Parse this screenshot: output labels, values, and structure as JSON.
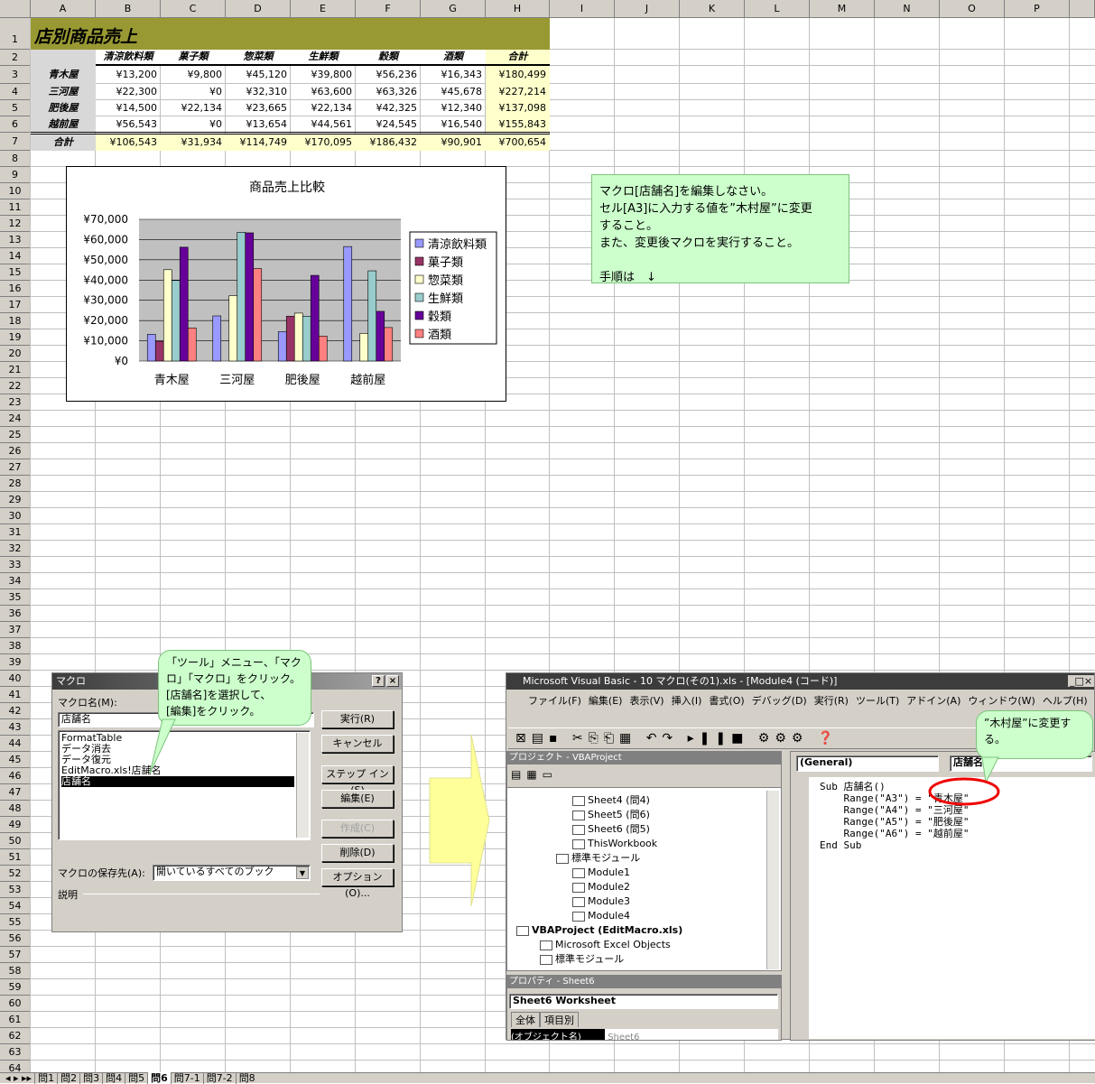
{
  "columns": [
    "A",
    "B",
    "C",
    "D",
    "E",
    "F",
    "G",
    "H",
    "I",
    "J",
    "K",
    "L",
    "M",
    "N",
    "O",
    "P"
  ],
  "sheet": {
    "title": "店別商品売上",
    "headers": [
      "清涼飲料類",
      "菓子類",
      "惣菜類",
      "生鮮類",
      "穀類",
      "酒類",
      "合計"
    ],
    "stores": [
      {
        "name": "青木屋",
        "values": [
          "¥13,200",
          "¥9,800",
          "¥45,120",
          "¥39,800",
          "¥56,236",
          "¥16,343",
          "¥180,499"
        ]
      },
      {
        "name": "三河屋",
        "values": [
          "¥22,300",
          "¥0",
          "¥32,310",
          "¥63,600",
          "¥63,326",
          "¥45,678",
          "¥227,214"
        ]
      },
      {
        "name": "肥後屋",
        "values": [
          "¥14,500",
          "¥22,134",
          "¥23,665",
          "¥22,134",
          "¥42,325",
          "¥12,340",
          "¥137,098"
        ]
      },
      {
        "name": "越前屋",
        "values": [
          "¥56,543",
          "¥0",
          "¥13,654",
          "¥44,561",
          "¥24,545",
          "¥16,540",
          "¥155,843"
        ]
      }
    ],
    "total": {
      "name": "合計",
      "values": [
        "¥106,543",
        "¥31,934",
        "¥114,749",
        "¥170,095",
        "¥186,432",
        "¥90,901",
        "¥700,654"
      ]
    }
  },
  "chart_data": {
    "type": "bar",
    "title": "商品売上比較",
    "categories": [
      "青木屋",
      "三河屋",
      "肥後屋",
      "越前屋"
    ],
    "ylim": [
      0,
      70000
    ],
    "yticks": [
      "¥0",
      "¥10,000",
      "¥20,000",
      "¥30,000",
      "¥40,000",
      "¥50,000",
      "¥60,000",
      "¥70,000"
    ],
    "legend_position": "right",
    "grid": true,
    "series": [
      {
        "name": "清涼飲料類",
        "color": "#9999ff",
        "values": [
          13200,
          22300,
          14500,
          56543
        ]
      },
      {
        "name": "菓子類",
        "color": "#993366",
        "values": [
          9800,
          0,
          22134,
          0
        ]
      },
      {
        "name": "惣菜類",
        "color": "#ffffcc",
        "values": [
          45120,
          32310,
          23665,
          13654
        ]
      },
      {
        "name": "生鮮類",
        "color": "#99cccc",
        "values": [
          39800,
          63600,
          22134,
          44561
        ]
      },
      {
        "name": "穀類",
        "color": "#660099",
        "values": [
          56236,
          63326,
          42325,
          24545
        ]
      },
      {
        "name": "酒類",
        "color": "#ff8080",
        "values": [
          16343,
          45678,
          12340,
          16540
        ]
      }
    ]
  },
  "note": {
    "lines": [
      "マクロ[店舗名]を編集しなさい。",
      "セル[A3]に入力する値を”木村屋”に変更",
      "すること。",
      "また、変更後マクロを実行すること。",
      "",
      "手順は　↓"
    ]
  },
  "macro_dialog": {
    "title": "マクロ",
    "help": "?",
    "close": "×",
    "name_label": "マクロ名(M):",
    "name_value": "店舗名",
    "list": [
      "FormatTable",
      "データ消去",
      "データ復元",
      "EditMacro.xls!店舗名",
      "店舗名"
    ],
    "selected": "店舗名",
    "buttons": [
      "実行(R)",
      "キャンセル",
      "ステップ イン(S)",
      "編集(E)",
      "作成(C)",
      "削除(D)",
      "オプション(O)..."
    ],
    "save_label": "マクロの保存先(A):",
    "save_value": "開いているすべてのブック",
    "desc_label": "説明"
  },
  "bubble1": {
    "lines": [
      "「ツール」メニュー、「マク",
      "ロ」「マクロ」をクリック。",
      "[店舗名]を選択して、",
      "[編集]をクリック。"
    ]
  },
  "vbe": {
    "title": "Microsoft Visual Basic - 10 マクロ(その1).xls - [Module4 (コード)]",
    "menus": [
      "ファイル(F)",
      "編集(E)",
      "表示(V)",
      "挿入(I)",
      "書式(O)",
      "デバッグ(D)",
      "実行(R)",
      "ツール(T)",
      "アドイン(A)",
      "ウィンドウ(W)",
      "ヘルプ(H)"
    ],
    "project_title": "プロジェクト - VBAProject",
    "tree": [
      {
        "label": "Sheet4 (問4)",
        "indent": 3
      },
      {
        "label": "Sheet5 (問6)",
        "indent": 3
      },
      {
        "label": "Sheet6 (問5)",
        "indent": 3
      },
      {
        "label": "ThisWorkbook",
        "indent": 3
      },
      {
        "label": "標準モジュール",
        "indent": 2
      },
      {
        "label": "Module1",
        "indent": 3
      },
      {
        "label": "Module2",
        "indent": 3
      },
      {
        "label": "Module3",
        "indent": 3
      },
      {
        "label": "Module4",
        "indent": 3
      },
      {
        "label": "VBAProject (EditMacro.xls)",
        "indent": 0
      },
      {
        "label": "Microsoft Excel Objects",
        "indent": 1
      },
      {
        "label": "標準モジュール",
        "indent": 1
      }
    ],
    "props_title": "プロパティ - Sheet6",
    "props_object": "Sheet6 Worksheet",
    "props_tabs": [
      "全体",
      "項目別"
    ],
    "props_row": "(オブジェクト名)",
    "props_value": "Sheet6",
    "general": "(General)",
    "proc": "店舗名",
    "code": [
      "Sub 店舗名()",
      "    Range(\"A3\") = \"青木屋\"",
      "    Range(\"A4\") = \"三河屋\"",
      "    Range(\"A5\") = \"肥後屋\"",
      "    Range(\"A6\") = \"越前屋\"",
      "End Sub"
    ]
  },
  "bubble2": {
    "lines": [
      "”木村屋”に変更す",
      "る。"
    ]
  },
  "tabs": [
    "問1",
    "問2",
    "問3",
    "問4",
    "問5",
    "問6",
    "問7-1",
    "問7-2",
    "問8"
  ],
  "active_tab": "問6"
}
